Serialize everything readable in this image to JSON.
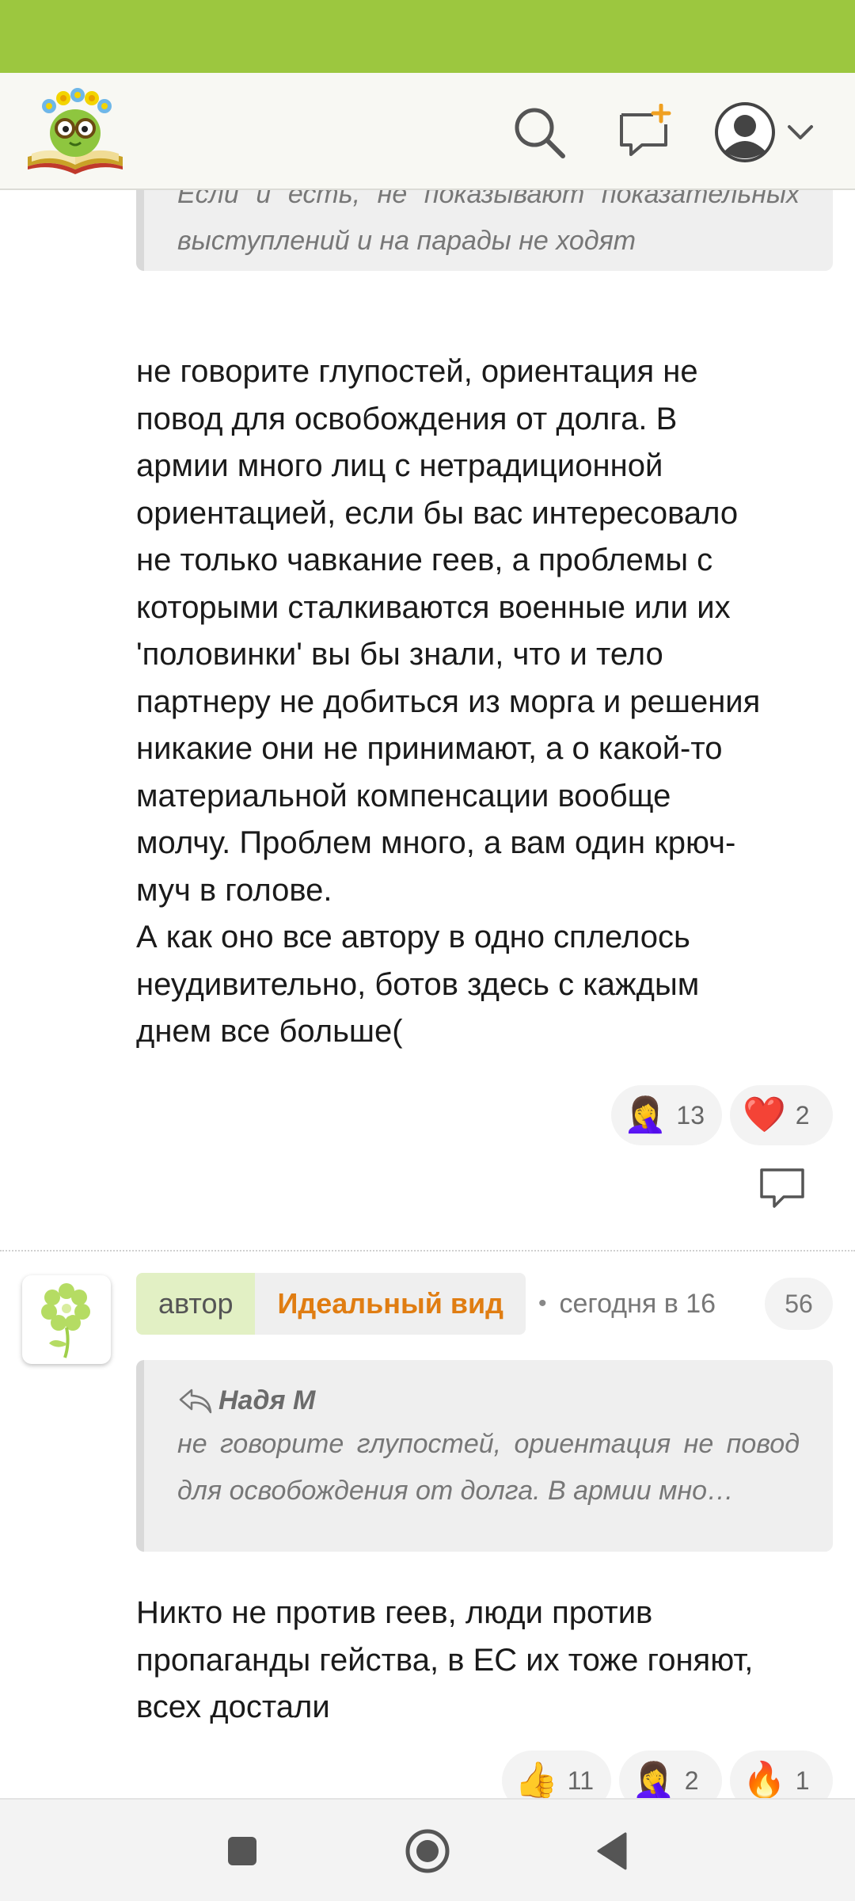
{
  "header": {
    "logo_icon": "book-bug-logo-icon",
    "search_icon": "search-icon",
    "compose_icon": "new-message-icon",
    "profile_icon": "user-avatar-icon",
    "profile_chevron_icon": "chevron-down-icon"
  },
  "thread": {
    "quote_top_text": "Если и есть, не показывают показательных выступлений и на парады не ходят",
    "post1_text": "не говорите глупостей, ориентация не\nповод для освобождения от долга. В\nармии много лиц с нетрадиционной\nориентацией, если бы вас интересовало\nне только чавкание геев, а проблемы с\nкоторыми сталкиваются военные или их\n'половинки' вы бы знали, что и тело\nпартнеру не добиться из морга и решения\nникакие они не принимают, а о какой-то\nматериальной компенсации вообще\nмолчу. Проблем много, а вам один крюч-\nмуч в голове.\nА как оно все автору в одно сплелось\nнеудивительно, ботов здесь с каждым\nднем все больше(",
    "post1_reactions": [
      {
        "emoji": "🤦‍♀️",
        "count": "13"
      },
      {
        "emoji": "❤️",
        "count": "2"
      }
    ],
    "reply_icon": "comment-reply-icon"
  },
  "comment2": {
    "avatar_icon": "flower-avatar-icon",
    "author_tag": "автор",
    "author_name": "Идеальный вид",
    "separator": "•",
    "time": "сегодня в 16",
    "badge_count": "56",
    "quote_author": "Надя М",
    "quote_text": "не говорите глупостей, ориентация не повод для освобождения от долга. В армии мно…",
    "text": "Никто не против геев, люди против\nпропаганды гейства, в ЕС их тоже гоняют,\nвсех достали",
    "reactions": [
      {
        "emoji": "👍",
        "count": "11"
      },
      {
        "emoji": "🤦‍♀️",
        "count": "2"
      },
      {
        "emoji": "🔥",
        "count": "1"
      }
    ]
  },
  "nav": {
    "recent_icon": "recent-apps-icon",
    "home_icon": "home-icon",
    "back_icon": "back-icon"
  },
  "colors": {
    "brand_green": "#9cc73f",
    "author_orange": "#e07d12",
    "tag_bg": "#e2f0c4"
  }
}
